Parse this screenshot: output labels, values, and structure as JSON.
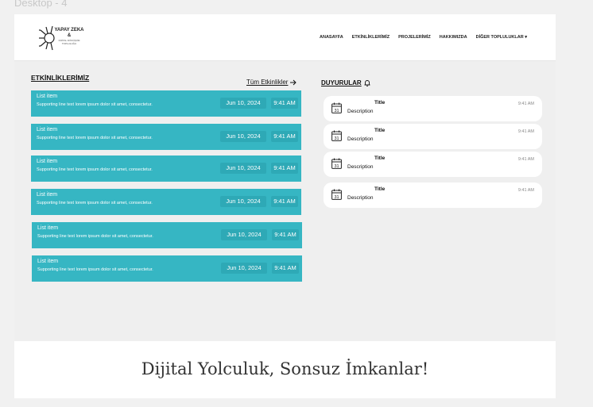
{
  "frame_label": "Desktop - 4",
  "logo": {
    "line1": "YAPAY ZEKA",
    "line2": "&",
    "line3": "DİJİTAL DÖNÜŞÜM TOPLULUĞU"
  },
  "nav": [
    "ANASAYFA",
    "ETKİNLİKLERİMİZ",
    "PROJELERİMİZ",
    "HAKKIMIZDA",
    "DİĞER TOPLULUKLAR ▾"
  ],
  "events": {
    "title": "ETKİNLİKLERİMİZ",
    "all_link": "Tüm Etkinlikler",
    "items": [
      {
        "title": "List item",
        "subtitle": "Supporting line text lorem ipsum dolor sit amet, consectetur.",
        "date": "Jun 10, 2024",
        "time": "9:41 AM"
      },
      {
        "title": "List item",
        "subtitle": "Supporting line text lorem ipsum dolor sit amet, consectetur.",
        "date": "Jun 10, 2024",
        "time": "9:41 AM"
      },
      {
        "title": "List item",
        "subtitle": "Supporting line text lorem ipsum dolor sit amet, consectetur.",
        "date": "Jun 10, 2024",
        "time": "9:41 AM"
      },
      {
        "title": "List item",
        "subtitle": "Supporting line text lorem ipsum dolor sit amet, consectetur.",
        "date": "Jun 10, 2024",
        "time": "9:41 AM"
      },
      {
        "title": "List item",
        "subtitle": "Supporting line text lorem ipsum dolor sit amet, consectetur.",
        "date": "Jun 10, 2024",
        "time": "9:41 AM"
      },
      {
        "title": "List item",
        "subtitle": "Supporting line text lorem ipsum dolor sit amet, consectetur.",
        "date": "Jun 10, 2024",
        "time": "9:41 AM"
      }
    ]
  },
  "announcements": {
    "title": "DUYURULAR",
    "calendar_day": "31",
    "items": [
      {
        "title": "Title",
        "description": "Description",
        "time": "9:41 AM"
      },
      {
        "title": "Title",
        "description": "Description",
        "time": "9:41 AM"
      },
      {
        "title": "Title",
        "description": "Description",
        "time": "9:41 AM"
      },
      {
        "title": "Title",
        "description": "Description",
        "time": "9:41 AM"
      }
    ]
  },
  "footer": {
    "tagline": "Dijital Yolculuk, Sonsuz İmkanlar!"
  },
  "colors": {
    "accent": "#36b6c3",
    "chip": "#2ea9b6",
    "header_bg": "#ffffff",
    "page_bg": "#efefef"
  }
}
